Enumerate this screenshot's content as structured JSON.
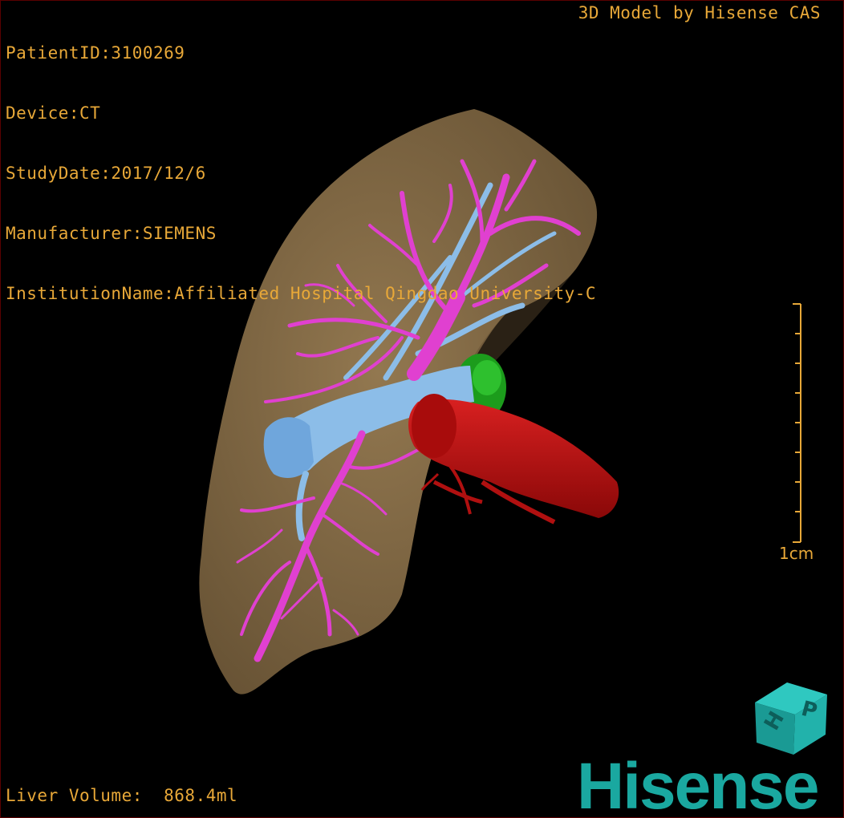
{
  "info": {
    "patient_id": "PatientID:3100269",
    "device": "Device:CT",
    "study_date": "StudyDate:2017/12/6",
    "manufacturer": "Manufacturer:SIEMENS",
    "institution": "InstitutionName:Affiliated Hospital Qingdao University-C"
  },
  "header": {
    "model_credit": "3D Model by Hisense CAS"
  },
  "footer": {
    "liver_volume": "Liver Volume:  868.4ml"
  },
  "scale_bar": {
    "label": "1cm",
    "ticks": 9
  },
  "brand": {
    "name": "Hisense",
    "cube_letters": [
      "H",
      "P"
    ]
  },
  "colors": {
    "text": "#e8a838",
    "liver": "#8a7048",
    "hepatic_vein": "#e040d0",
    "portal_vein": "#8ec0ea",
    "artery": "#c01010",
    "gallbladder": "#20b020",
    "brand": "#1aa8a0"
  }
}
